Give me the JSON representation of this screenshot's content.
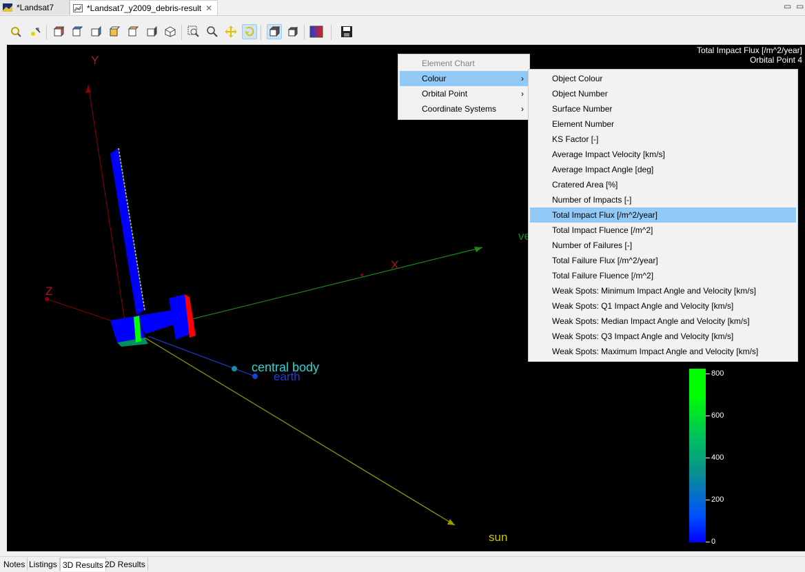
{
  "tabs": [
    {
      "label": "*Landsat7"
    },
    {
      "label": "*Landsat7_y2009_debris-result"
    }
  ],
  "window_controls": {
    "minimize": "▭",
    "maximize": "▭"
  },
  "toolbar": {
    "icons": [
      "zoom-fit-icon",
      "pick-icon",
      "view-front-icon",
      "view-back-icon",
      "view-left-icon",
      "view-right-icon",
      "view-top-icon",
      "view-bottom-icon",
      "view-iso-icon",
      "zoom-box-icon",
      "zoom-icon",
      "pan-icon",
      "rotate-icon",
      "perspective-icon",
      "orthographic-icon",
      "colour-map-icon",
      "save-icon"
    ]
  },
  "viewport": {
    "title_line1": "Total Impact Flux [/m^2/year]",
    "title_line2": "Orbital Point 4",
    "axis_labels": {
      "y": "Y",
      "x": "X",
      "z": "Z"
    },
    "labels": {
      "velocity": "ve",
      "central_body": "central body",
      "earth": "earth",
      "sun": "sun"
    },
    "legend_ticks": [
      "800",
      "600",
      "400",
      "200",
      "0"
    ],
    "legend_values": [
      800,
      600,
      400,
      200,
      0
    ],
    "colors": {
      "background": "#000000",
      "panel": "#0000ff",
      "axis_y": "#8b0000",
      "axis_x": "#1a8a1a",
      "sun": "#9a9a00",
      "central_body_label": "#2fd3d3",
      "earth_label": "#1a3fd6"
    }
  },
  "context_menu": {
    "items": [
      {
        "label": "Element Chart",
        "disabled": true
      },
      {
        "label": "Colour",
        "submenu": true,
        "highlighted": true
      },
      {
        "label": "Orbital Point",
        "submenu": true
      },
      {
        "label": "Coordinate Systems",
        "submenu": true
      }
    ]
  },
  "colour_submenu": {
    "items": [
      {
        "label": "Object Colour"
      },
      {
        "label": "Object Number"
      },
      {
        "label": "Surface Number"
      },
      {
        "label": "Element Number"
      },
      {
        "label": "KS Factor [-]"
      },
      {
        "label": "Average Impact Velocity [km/s]"
      },
      {
        "label": "Average Impact Angle [deg]"
      },
      {
        "label": "Cratered Area [%]"
      },
      {
        "label": "Number of Impacts [-]"
      },
      {
        "label": "Total Impact Flux [/m^2/year]",
        "highlighted": true
      },
      {
        "label": "Total Impact Fluence [/m^2]"
      },
      {
        "label": "Number of Failures [-]"
      },
      {
        "label": "Total Failure Flux [/m^2/year]"
      },
      {
        "label": "Total Failure Fluence [/m^2]"
      },
      {
        "label": "Weak Spots: Minimum Impact Angle and Velocity [km/s]"
      },
      {
        "label": "Weak Spots: Q1 Impact Angle and Velocity [km/s]"
      },
      {
        "label": "Weak Spots: Median Impact Angle and Velocity [km/s]"
      },
      {
        "label": "Weak Spots: Q3 Impact Angle and Velocity [km/s]"
      },
      {
        "label": "Weak Spots: Maximum Impact Angle and Velocity [km/s]"
      }
    ]
  },
  "bottom_tabs": [
    {
      "label": "Notes"
    },
    {
      "label": "Listings"
    },
    {
      "label": "3D Results",
      "active": true
    },
    {
      "label": "2D Results"
    }
  ]
}
